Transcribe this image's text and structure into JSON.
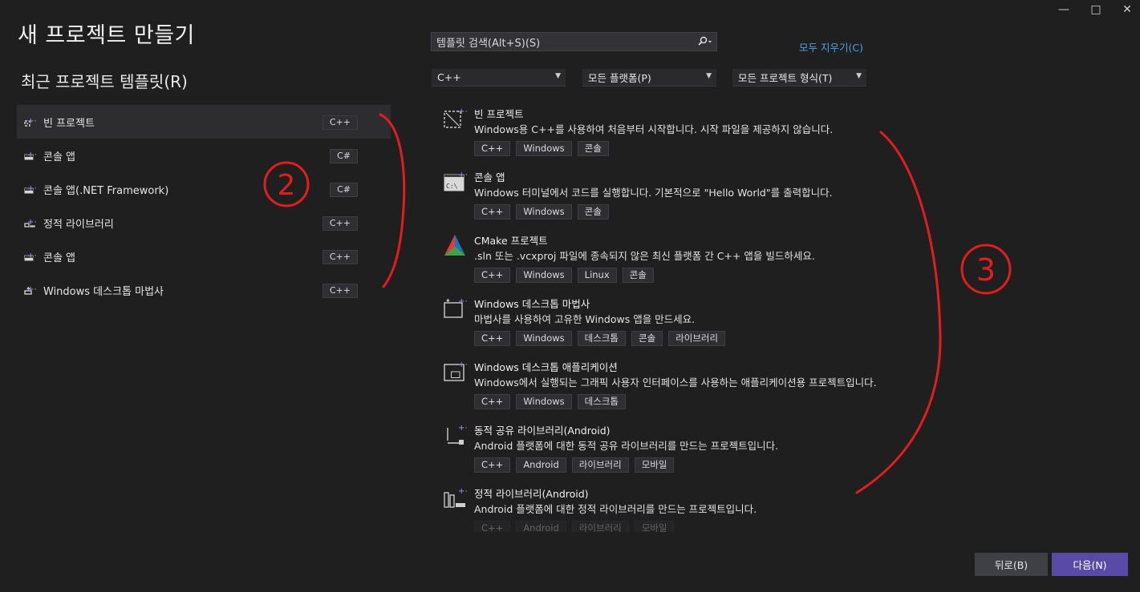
{
  "window": {
    "minimize_glyph": "—",
    "maximize_glyph": "□",
    "close_glyph": "✕"
  },
  "page_title": "새 프로젝트 만들기",
  "recent": {
    "title": "최근 프로젝트 템플릿(R)",
    "items": [
      {
        "label": "빈 프로젝트",
        "lang": "C++",
        "icon": "empty-project-icon"
      },
      {
        "label": "콘솔 앱",
        "lang": "C#",
        "icon": "console-app-icon"
      },
      {
        "label": "콘솔 앱(.NET Framework)",
        "lang": "C#",
        "icon": "console-app-icon"
      },
      {
        "label": "정적 라이브러리",
        "lang": "C++",
        "icon": "static-library-icon"
      },
      {
        "label": "콘솔 앱",
        "lang": "C++",
        "icon": "console-app-icon"
      },
      {
        "label": "Windows 데스크톱 마법사",
        "lang": "C++",
        "icon": "desktop-wizard-icon"
      }
    ]
  },
  "search": {
    "placeholder": "템플릿 검색(Alt+S)(S)",
    "icon": "search-icon"
  },
  "clear_all": "모두 지우기(C)",
  "filters": {
    "language": "C++",
    "platform": "모든 플랫폼(P)",
    "project_type": "모든 프로젝트 형식(T)"
  },
  "templates": [
    {
      "name": "빈 프로젝트",
      "desc": "Windows용 C++를 사용하여 처음부터 시작합니다. 시작 파일을 제공하지 않습니다.",
      "tags": [
        "C++",
        "Windows",
        "콘솔"
      ],
      "icon": "empty-project-icon"
    },
    {
      "name": "콘솔 앱",
      "desc": "Windows 터미널에서 코드를 실행합니다. 기본적으로 \"Hello World\"를 출력합니다.",
      "tags": [
        "C++",
        "Windows",
        "콘솔"
      ],
      "icon": "console-app-icon"
    },
    {
      "name": "CMake 프로젝트",
      "desc": ".sln 또는 .vcxproj 파일에 종속되지 않은 최신 플랫폼 간 C++ 앱을 빌드하세요.",
      "tags": [
        "C++",
        "Windows",
        "Linux",
        "콘솔"
      ],
      "icon": "cmake-icon"
    },
    {
      "name": "Windows 데스크톱 마법사",
      "desc": "마법사를 사용하여 고유한 Windows 앱을 만드세요.",
      "tags": [
        "C++",
        "Windows",
        "데스크톱",
        "콘솔",
        "라이브러리"
      ],
      "icon": "desktop-wizard-icon"
    },
    {
      "name": "Windows 데스크톱 애플리케이션",
      "desc": "Windows에서 실행되는 그래픽 사용자 인터페이스를 사용하는 애플리케이션용 프로젝트입니다.",
      "tags": [
        "C++",
        "Windows",
        "데스크톱"
      ],
      "icon": "desktop-app-icon"
    },
    {
      "name": "동적 공유 라이브러리(Android)",
      "desc": "Android 플랫폼에 대한 동적 공유 라이브러리를 만드는 프로젝트입니다.",
      "tags": [
        "C++",
        "Android",
        "라이브러리",
        "모바일"
      ],
      "icon": "shared-library-icon"
    },
    {
      "name": "정적 라이브러리(Android)",
      "desc": "Android 플랫폼에 대한 정적 라이브러리를 만드는 프로젝트입니다.",
      "tags": [
        "C++",
        "Android",
        "라이브러리",
        "모바일"
      ],
      "icon": "static-library-icon"
    }
  ],
  "buttons": {
    "back": "뒤로(B)",
    "next": "다음(N)"
  },
  "annotations": {
    "label_2": "2",
    "label_3": "3",
    "color": "#e11d1d"
  },
  "colors": {
    "accent": "#5a4aa8",
    "link": "#4fa0e8",
    "icon_plus": "#b58cff"
  }
}
